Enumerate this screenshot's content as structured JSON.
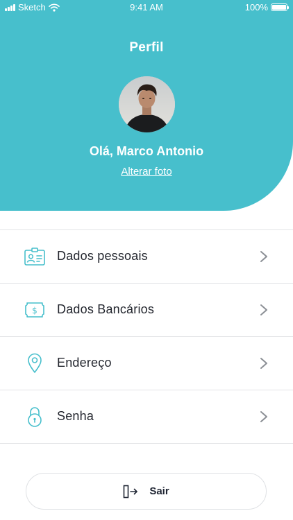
{
  "status_bar": {
    "carrier": "Sketch",
    "time": "9:41 AM",
    "battery": "100%"
  },
  "header": {
    "title": "Perfil",
    "greeting": "Olá, Marco Antonio",
    "change_photo": "Alterar foto",
    "background_color": "#47bfcc"
  },
  "menu": {
    "items": [
      {
        "label": "Dados pessoais",
        "icon": "id-card-icon"
      },
      {
        "label": "Dados Bancários",
        "icon": "money-icon"
      },
      {
        "label": "Endereço",
        "icon": "location-pin-icon"
      },
      {
        "label": "Senha",
        "icon": "lock-icon"
      }
    ]
  },
  "logout": {
    "label": "Sair",
    "icon": "exit-icon"
  },
  "colors": {
    "accent": "#47bfcc",
    "text": "#23262e",
    "divider": "#e2e3e6"
  }
}
